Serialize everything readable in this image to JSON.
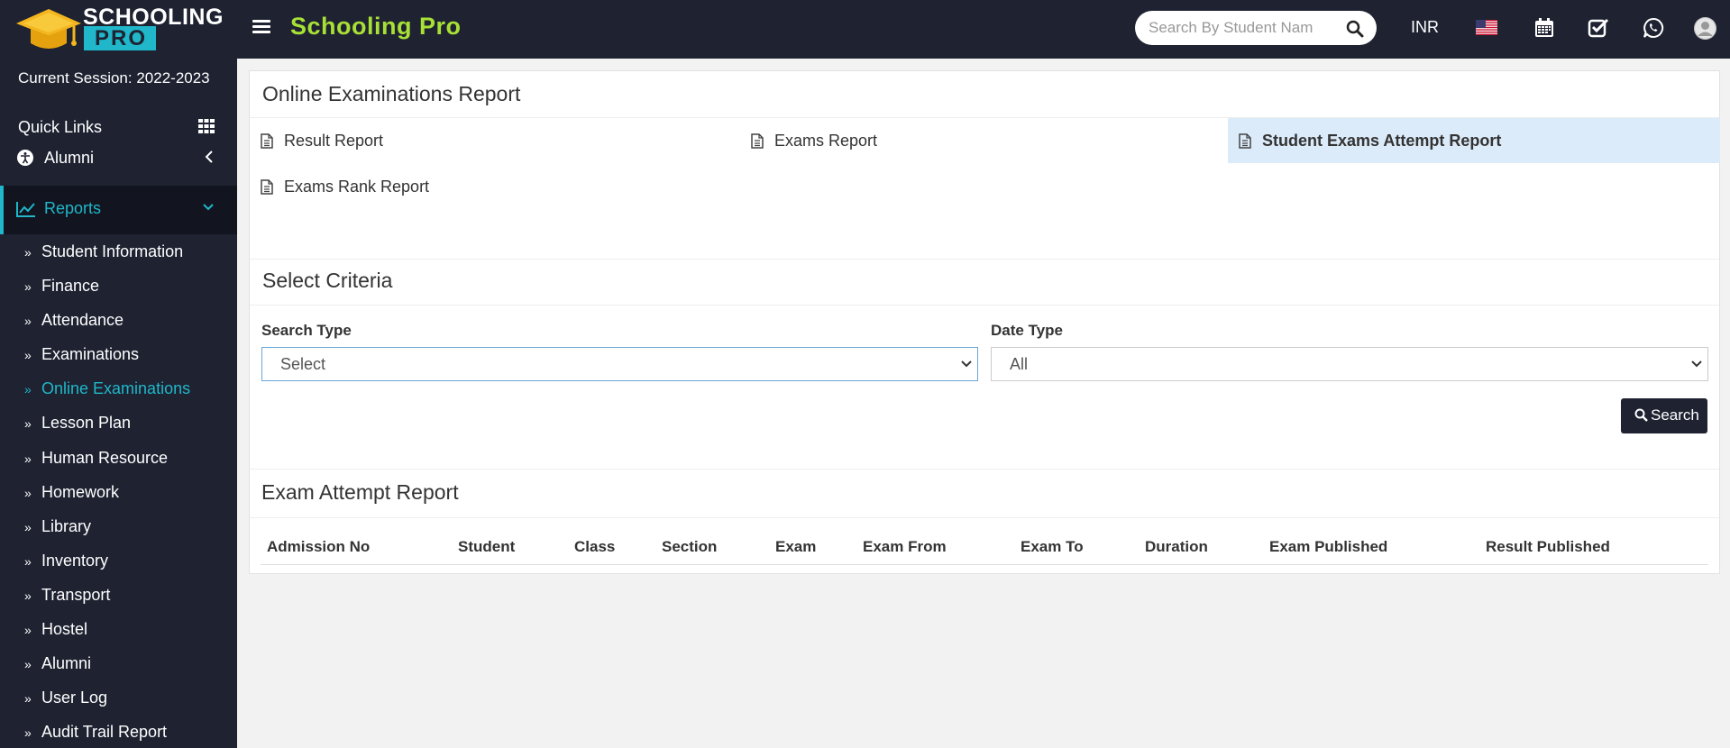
{
  "app": {
    "logo_line1": "SCHOOLING",
    "logo_line2": "PRO",
    "title": "Schooling Pro"
  },
  "topbar": {
    "search_placeholder": "Search By Student Nam",
    "currency": "INR",
    "icons": [
      "flag-us-icon",
      "calendar-icon",
      "checkbox-icon",
      "whatsapp-icon",
      "user-avatar-icon"
    ]
  },
  "sidebar": {
    "session": "Current Session: 2022-2023",
    "quick_links": "Quick Links",
    "alumni_top": "Alumni",
    "reports": "Reports",
    "items": [
      {
        "label": "Student Information"
      },
      {
        "label": "Finance"
      },
      {
        "label": "Attendance"
      },
      {
        "label": "Examinations"
      },
      {
        "label": "Online Examinations",
        "active": true
      },
      {
        "label": "Lesson Plan"
      },
      {
        "label": "Human Resource"
      },
      {
        "label": "Homework"
      },
      {
        "label": "Library"
      },
      {
        "label": "Inventory"
      },
      {
        "label": "Transport"
      },
      {
        "label": "Hostel"
      },
      {
        "label": "Alumni"
      },
      {
        "label": "User Log"
      },
      {
        "label": "Audit Trail Report"
      }
    ]
  },
  "main": {
    "report_title": "Online Examinations Report",
    "reports": [
      {
        "label": "Result Report"
      },
      {
        "label": "Exams Report"
      },
      {
        "label": "Student Exams Attempt Report",
        "active": true
      },
      {
        "label": "Exams Rank Report"
      }
    ],
    "criteria_title": "Select Criteria",
    "search_type_label": "Search Type",
    "search_type_value": "Select",
    "date_type_label": "Date Type",
    "date_type_value": "All",
    "search_button": "Search",
    "attempt_title": "Exam Attempt Report",
    "table_headers": [
      "Admission No",
      "Student",
      "Class",
      "Section",
      "Exam",
      "Exam From",
      "Exam To",
      "Duration",
      "Exam Published",
      "Result Published"
    ]
  },
  "colors": {
    "sidebar_bg": "#1e2231",
    "accent": "#1fb7c9",
    "title_green": "#a8e036",
    "active_row": "#dcebf9"
  }
}
